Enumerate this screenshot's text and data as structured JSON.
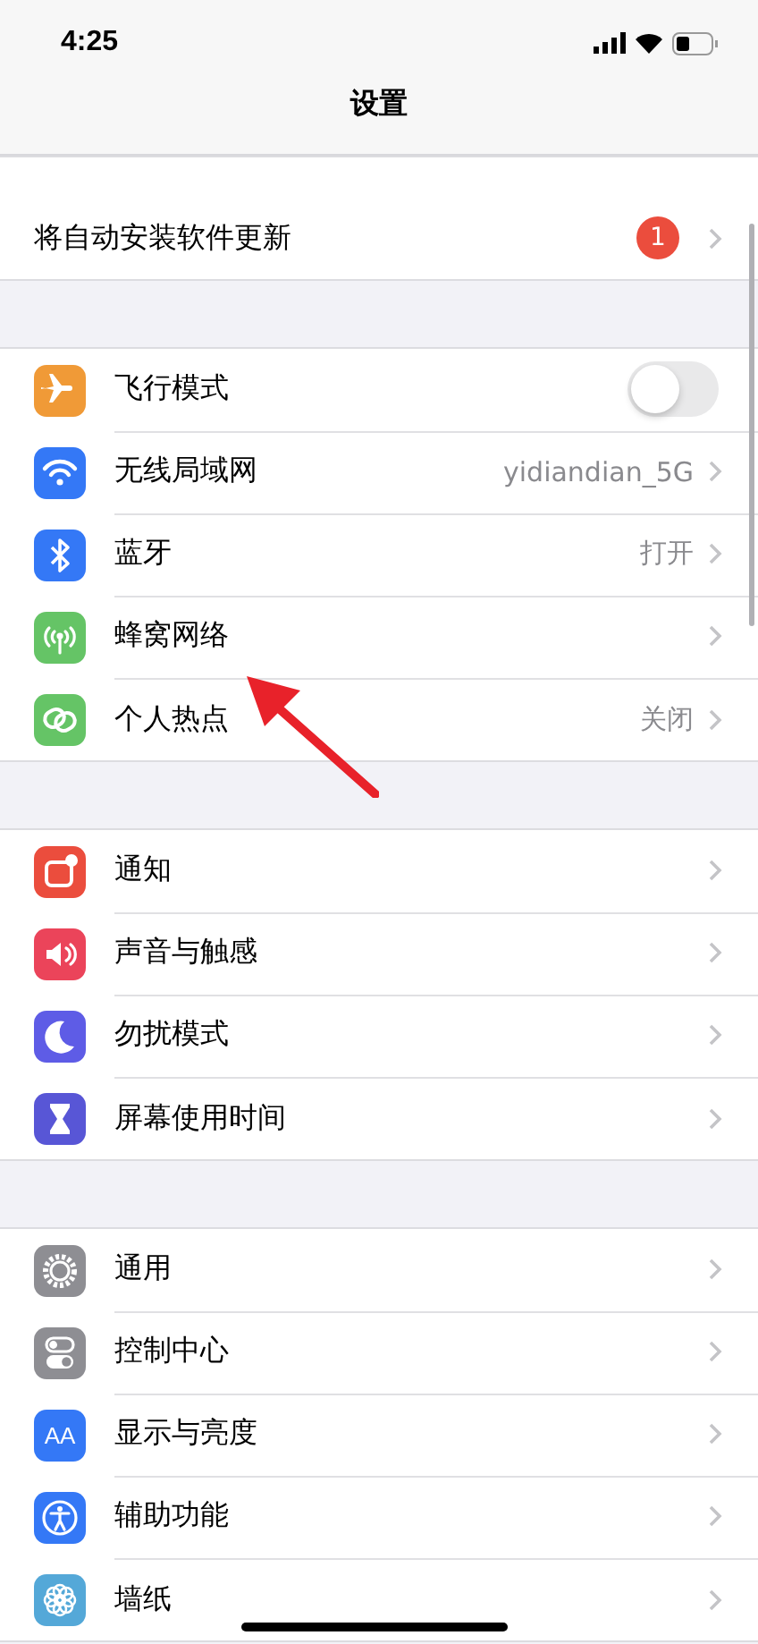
{
  "status_bar": {
    "time": "4:25"
  },
  "nav": {
    "title": "设置"
  },
  "groups": [
    {
      "rows": [
        {
          "label": "将自动安装软件更新",
          "kind": "link",
          "badge": "1"
        }
      ]
    },
    {
      "rows": [
        {
          "label": "飞行模式",
          "kind": "toggle",
          "color": "#f09a37",
          "on": false
        },
        {
          "label": "无线局域网",
          "kind": "link",
          "color": "#3478f6",
          "value": "yidiandian_5G"
        },
        {
          "label": "蓝牙",
          "kind": "link",
          "color": "#3478f6",
          "value": "打开"
        },
        {
          "label": "蜂窝网络",
          "kind": "link",
          "color": "#65c466"
        },
        {
          "label": "个人热点",
          "kind": "link",
          "color": "#65c466",
          "value": "关闭"
        }
      ]
    },
    {
      "rows": [
        {
          "label": "通知",
          "kind": "link",
          "color": "#eb4d3d"
        },
        {
          "label": "声音与触感",
          "kind": "link",
          "color": "#eb445a"
        },
        {
          "label": "勿扰模式",
          "kind": "link",
          "color": "#5e5ce6"
        },
        {
          "label": "屏幕使用时间",
          "kind": "link",
          "color": "#5856d6"
        }
      ]
    },
    {
      "rows": [
        {
          "label": "通用",
          "kind": "link",
          "color": "#8e8e93"
        },
        {
          "label": "控制中心",
          "kind": "link",
          "color": "#8e8e93"
        },
        {
          "label": "显示与亮度",
          "kind": "link",
          "icon_text": "AA",
          "color": "#3478f6"
        },
        {
          "label": "辅助功能",
          "kind": "link",
          "color": "#3478f6"
        },
        {
          "label": "墙纸",
          "kind": "link",
          "color": "#54a8d8"
        }
      ]
    }
  ]
}
